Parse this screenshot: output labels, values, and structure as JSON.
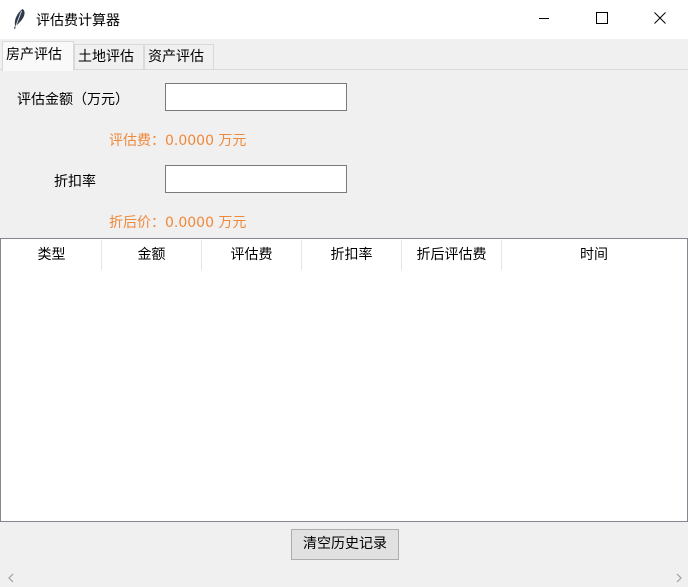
{
  "window": {
    "title": "评估费计算器"
  },
  "tabs": [
    {
      "label": "房产评估",
      "active": true
    },
    {
      "label": "土地评估",
      "active": false
    },
    {
      "label": "资产评估",
      "active": false
    }
  ],
  "form": {
    "amount_label": "评估金额（万元）",
    "amount_value": "",
    "fee_result": "评估费：0.0000 万元",
    "discount_label": "折扣率",
    "discount_value": "",
    "discounted_result": "折后价：0.0000 万元"
  },
  "table": {
    "columns": [
      "类型",
      "金额",
      "评估费",
      "折扣率",
      "折后评估费",
      "时间"
    ],
    "rows": []
  },
  "actions": {
    "clear_history_label": "清空历史记录"
  },
  "colors": {
    "result_text": "#f0883a"
  },
  "icons": {
    "app": "feather-icon",
    "minimize": "minimize-icon",
    "maximize": "maximize-icon",
    "close": "close-icon"
  }
}
